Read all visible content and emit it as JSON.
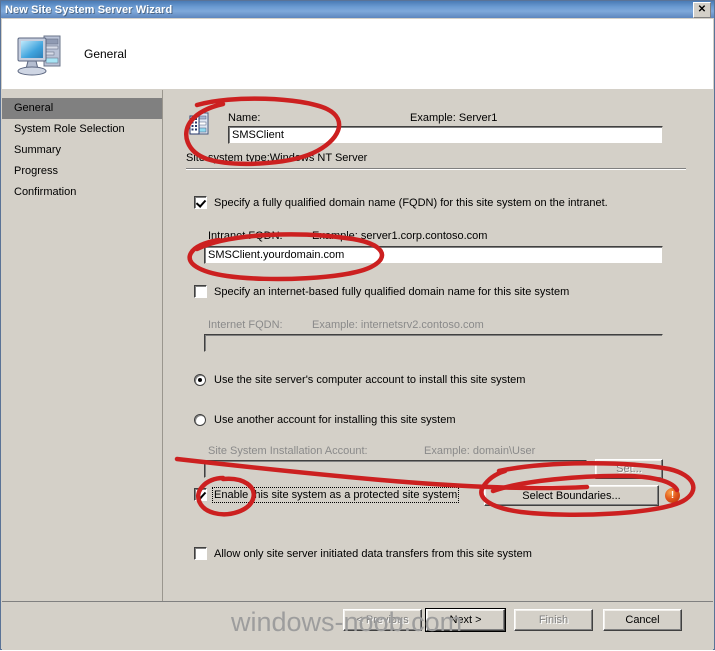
{
  "window": {
    "title": "New Site System Server Wizard",
    "close_label": "✕"
  },
  "header": {
    "title": "General",
    "icon": "computer-icon"
  },
  "sidebar": {
    "items": [
      {
        "label": "General",
        "selected": true
      },
      {
        "label": "System Role Selection",
        "selected": false
      },
      {
        "label": "Summary",
        "selected": false
      },
      {
        "label": "Progress",
        "selected": false
      },
      {
        "label": "Confirmation",
        "selected": false
      }
    ]
  },
  "form": {
    "name_label": "Name:",
    "name_example": "Example: Server1",
    "name_value": "SMSClient",
    "site_system_type": "Site system type:Windows NT Server",
    "fqdn_checkbox_label": "Specify a fully qualified domain name (FQDN) for this site system on the intranet.",
    "fqdn_checkbox_checked": true,
    "intranet_fqdn_label": "Intranet FQDN:",
    "intranet_fqdn_example": "Example: server1.corp.contoso.com",
    "intranet_fqdn_value": "SMSClient.yourdomain.com",
    "internet_checkbox_label": "Specify an internet-based fully qualified domain name for this site system",
    "internet_checkbox_checked": false,
    "internet_fqdn_label": "Internet FQDN:",
    "internet_fqdn_example": "Example: internetsrv2.contoso.com",
    "internet_fqdn_value": "",
    "radio_computer_account_label": "Use the site server's computer account to install this site system",
    "radio_computer_account_selected": true,
    "radio_another_account_label": "Use another account for installing this site system",
    "radio_another_account_selected": false,
    "install_account_label": "Site System Installation Account:",
    "install_account_example": "Example: domain\\User",
    "install_account_value": "",
    "set_button_label": "Set...",
    "protected_checkbox_label": "Enable this site system as a protected site system",
    "protected_checkbox_checked": true,
    "select_boundaries_label": "Select Boundaries...",
    "boundaries_error_icon": "error-icon",
    "boundaries_error_glyph": "!",
    "server_initiated_label": "Allow only site server initiated data transfers from this site system",
    "server_initiated_checked": false
  },
  "footer": {
    "previous_label": "< Previous",
    "next_label": "Next >",
    "finish_label": "Finish",
    "cancel_label": "Cancel"
  },
  "watermark": {
    "text": "windows-noob.com"
  },
  "colors": {
    "title_bar": "#6b9bd2",
    "dialog_face": "#d4d0c8",
    "selection": "#808080",
    "annotation_red": "#cc2222",
    "error_orange": "#e2591c"
  }
}
